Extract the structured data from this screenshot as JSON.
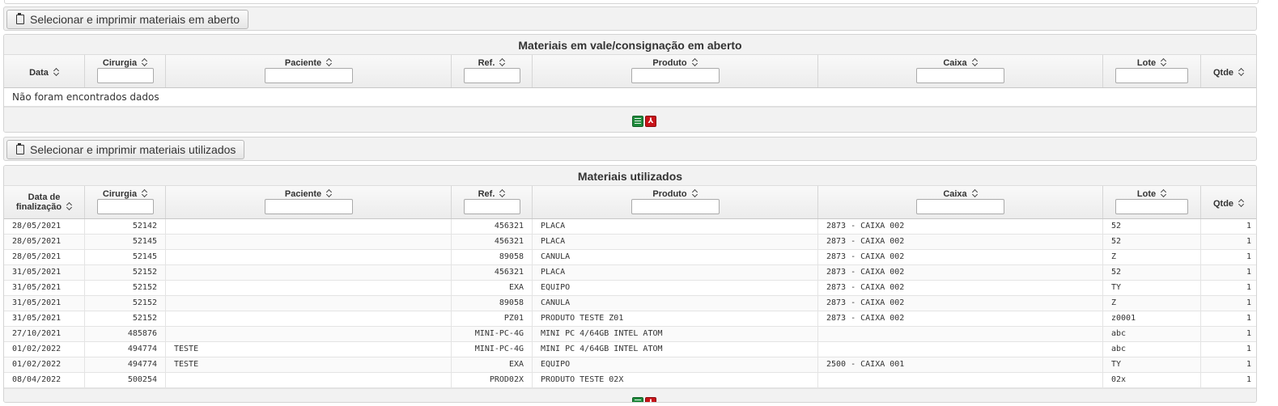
{
  "section1": {
    "button_label": "Selecionar e imprimir materiais em aberto",
    "title": "Materiais em vale/consignação em aberto",
    "columns": {
      "data": "Data",
      "cirurgia": "Cirurgia",
      "paciente": "Paciente",
      "ref": "Ref.",
      "produto": "Produto",
      "caixa": "Caixa",
      "lote": "Lote",
      "qtde": "Qtde"
    },
    "empty_message": "Não foram encontrados dados"
  },
  "section2": {
    "button_label": "Selecionar e imprimir materiais utilizados",
    "title": "Materiais utilizados",
    "columns": {
      "data_line1": "Data de",
      "data_line2": "finalização",
      "cirurgia": "Cirurgia",
      "paciente": "Paciente",
      "ref": "Ref.",
      "produto": "Produto",
      "caixa": "Caixa",
      "lote": "Lote",
      "qtde": "Qtde"
    },
    "rows": [
      {
        "data": "28/05/2021",
        "cirurgia": "52142",
        "paciente": "",
        "ref": "456321",
        "produto": "PLACA",
        "caixa": "2873 - CAIXA 002",
        "lote": "52",
        "qtde": "1"
      },
      {
        "data": "28/05/2021",
        "cirurgia": "52145",
        "paciente": "",
        "ref": "456321",
        "produto": "PLACA",
        "caixa": "2873 - CAIXA 002",
        "lote": "52",
        "qtde": "1"
      },
      {
        "data": "28/05/2021",
        "cirurgia": "52145",
        "paciente": "",
        "ref": "89058",
        "produto": "CANULA",
        "caixa": "2873 - CAIXA 002",
        "lote": "Z",
        "qtde": "1"
      },
      {
        "data": "31/05/2021",
        "cirurgia": "52152",
        "paciente": "",
        "ref": "456321",
        "produto": "PLACA",
        "caixa": "2873 - CAIXA 002",
        "lote": "52",
        "qtde": "1"
      },
      {
        "data": "31/05/2021",
        "cirurgia": "52152",
        "paciente": "",
        "ref": "EXA",
        "produto": "EQUIPO",
        "caixa": "2873 - CAIXA 002",
        "lote": "TY",
        "qtde": "1"
      },
      {
        "data": "31/05/2021",
        "cirurgia": "52152",
        "paciente": "",
        "ref": "89058",
        "produto": "CANULA",
        "caixa": "2873 - CAIXA 002",
        "lote": "Z",
        "qtde": "1"
      },
      {
        "data": "31/05/2021",
        "cirurgia": "52152",
        "paciente": "",
        "ref": "PZ01",
        "produto": "PRODUTO TESTE Z01",
        "caixa": "2873 - CAIXA 002",
        "lote": "z0001",
        "qtde": "1"
      },
      {
        "data": "27/10/2021",
        "cirurgia": "485876",
        "paciente": "",
        "ref": "MINI-PC-4G",
        "produto": "MINI PC 4/64GB INTEL ATOM",
        "caixa": "",
        "lote": "abc",
        "qtde": "1"
      },
      {
        "data": "01/02/2022",
        "cirurgia": "494774",
        "paciente": "TESTE",
        "ref": "MINI-PC-4G",
        "produto": "MINI PC 4/64GB INTEL ATOM",
        "caixa": "",
        "lote": "abc",
        "qtde": "1"
      },
      {
        "data": "01/02/2022",
        "cirurgia": "494774",
        "paciente": "TESTE",
        "ref": "EXA",
        "produto": "EQUIPO",
        "caixa": "2500 - CAIXA 001",
        "lote": "TY",
        "qtde": "1"
      },
      {
        "data": "08/04/2022",
        "cirurgia": "500254",
        "paciente": "",
        "ref": "PROD02X",
        "produto": "PRODUTO TESTE 02X",
        "caixa": "",
        "lote": "02x",
        "qtde": "1"
      }
    ]
  },
  "export": {
    "excel_icon": "excel-icon",
    "pdf_icon": "pdf-icon",
    "pdf_glyph": "⅄"
  },
  "colors": {
    "excel": "#1f8a3c",
    "pdf": "#c8141a",
    "header_bg": "#ececec"
  }
}
